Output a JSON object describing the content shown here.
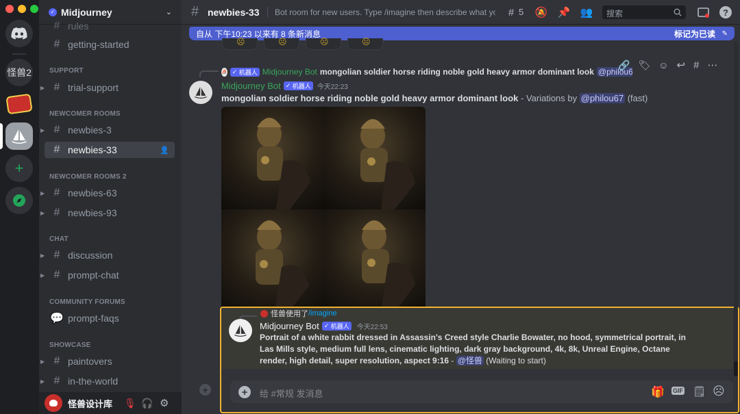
{
  "window": {
    "traffic_lights": [
      "#ff5f57",
      "#febc2e",
      "#28c840"
    ]
  },
  "servers": [
    {
      "name": "discord-home",
      "label": ""
    },
    {
      "name": "server-guaishou2",
      "label": "怪兽2"
    },
    {
      "name": "server-red-logo",
      "label": ""
    },
    {
      "name": "server-midjourney",
      "label": ""
    },
    {
      "name": "add-server",
      "label": "+"
    },
    {
      "name": "explore-servers",
      "label": ""
    }
  ],
  "sidebar": {
    "server_name": "Midjourney",
    "partial_top": "rules",
    "channels_top": [
      {
        "label": "getting-started"
      }
    ],
    "categories": [
      {
        "title": "SUPPORT",
        "channels": [
          {
            "label": "trial-support"
          }
        ]
      },
      {
        "title": "NEWCOMER ROOMS",
        "channels": [
          {
            "label": "newbies-3"
          },
          {
            "label": "newbies-33"
          }
        ]
      },
      {
        "title": "NEWCOMER ROOMS 2",
        "channels": [
          {
            "label": "newbies-63"
          },
          {
            "label": "newbies-93"
          }
        ]
      },
      {
        "title": "CHAT",
        "channels": [
          {
            "label": "discussion"
          },
          {
            "label": "prompt-chat"
          }
        ]
      },
      {
        "title": "COMMUNITY FORUMS",
        "channels": [
          {
            "label": "prompt-faqs"
          }
        ]
      },
      {
        "title": "SHOWCASE",
        "channels": [
          {
            "label": "paintovers"
          },
          {
            "label": "in-the-world"
          }
        ]
      }
    ],
    "user": {
      "name": "怪兽设计库"
    }
  },
  "topbar": {
    "channel": "newbies-33",
    "topic": "Bot room for new users. Type /imagine then describe what you...",
    "thread_count": "5",
    "search_placeholder": "搜索"
  },
  "chat": {
    "new_messages": "自从 下午10:23 以来有 8 条新消息",
    "mark_read": "标记为已读",
    "reply_preview": {
      "badge": "机器人",
      "author": "Midjourney Bot",
      "text": "mongolian soldier horse riding noble gold heavy armor dominant look",
      "mention": "@philou67",
      "tail": "..."
    },
    "message1": {
      "author": "Midjourney Bot",
      "badge": "机器人",
      "time": "今天22:23",
      "prompt": "mongolian soldier horse riding noble gold heavy armor dominant look",
      "suffix": " - Variations by ",
      "mention": "@philou67",
      "mode": " (fast)"
    },
    "message2": {
      "used_by": "怪兽使用了",
      "command": "/imagine",
      "author": "Midjourney Bot",
      "badge": "机器人",
      "time": "今天22:53",
      "prompt": "Portrait of a white rabbit dressed in Assassin's Creed style Charlie Bowater, no hood, symmetrical portrait, in Las Mills style, medium full lens, cinematic lighting, dark gray background, 4k, 8k, Unreal Engine, Octane render, high detail, super resolution, aspect 9:16",
      "separator": " - ",
      "mention": "@怪兽",
      "status": " (Waiting to start)"
    },
    "composer_placeholder": "给 #常规 发消息",
    "gif_label": "GIF"
  }
}
